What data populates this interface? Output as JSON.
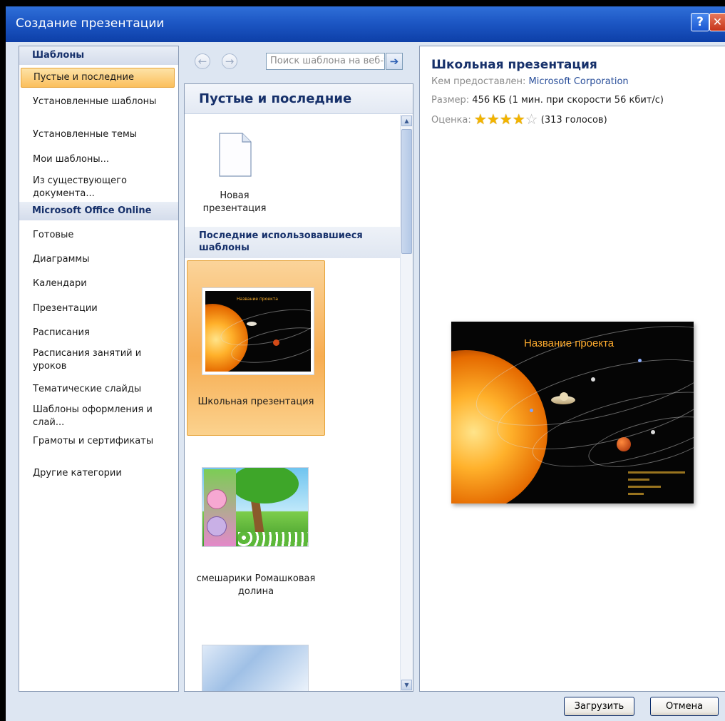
{
  "window": {
    "title": "Создание презентации",
    "help_label": "?",
    "close_label": "✕"
  },
  "left_nav": {
    "templates_header": "Шаблоны",
    "items": [
      {
        "label": "Пустые и последние"
      },
      {
        "label": "Установленные шаблоны"
      },
      {
        "label": "Установленные темы"
      },
      {
        "label": "Мои шаблоны..."
      },
      {
        "label": "Из существующего документа..."
      }
    ],
    "online_header": "Microsoft Office Online",
    "online_items": [
      {
        "label": "Готовые"
      },
      {
        "label": "Диаграммы"
      },
      {
        "label": "Календари"
      },
      {
        "label": "Презентации"
      },
      {
        "label": "Расписания"
      },
      {
        "label": "Расписания занятий и уроков"
      },
      {
        "label": "Тематические слайды"
      },
      {
        "label": "Шаблоны оформления и слай..."
      },
      {
        "label": "Грамоты и сертификаты"
      },
      {
        "label": "Другие категории"
      }
    ]
  },
  "search": {
    "placeholder": "Поиск шаблона на веб-узле Microsoft Office Online",
    "back_icon": "←",
    "forward_icon": "→",
    "go_icon": "➔"
  },
  "middle": {
    "title": "Пустые и последние",
    "new_presentation_label": "Новая презентация",
    "recent_header": "Последние использовавшиеся шаблоны",
    "templates": [
      {
        "label": "Школьная презентация",
        "selected": true,
        "slide_title": "Название проекта"
      },
      {
        "label": "смешарики Ромашковая долина",
        "selected": false
      },
      {
        "label": "",
        "selected": false
      }
    ]
  },
  "preview": {
    "title": "Школьная презентация",
    "provider_key": "Кем предоставлен:",
    "provider_value": "Microsoft Corporation",
    "size_key": "Размер:",
    "size_value": "456 КБ (1 мин. при скорости 56 кбит/с)",
    "rating_key": "Оценка:",
    "rating_value": 4,
    "rating_max": 5,
    "votes": "(313 голосов)",
    "slide_title": "Название проекта"
  },
  "buttons": {
    "download": "Загрузить",
    "cancel": "Отмена"
  },
  "colors": {
    "title_bar": "#1d57c4",
    "selection": "#fbbf5c",
    "header_text": "#16306a",
    "star": "#f2b400"
  }
}
